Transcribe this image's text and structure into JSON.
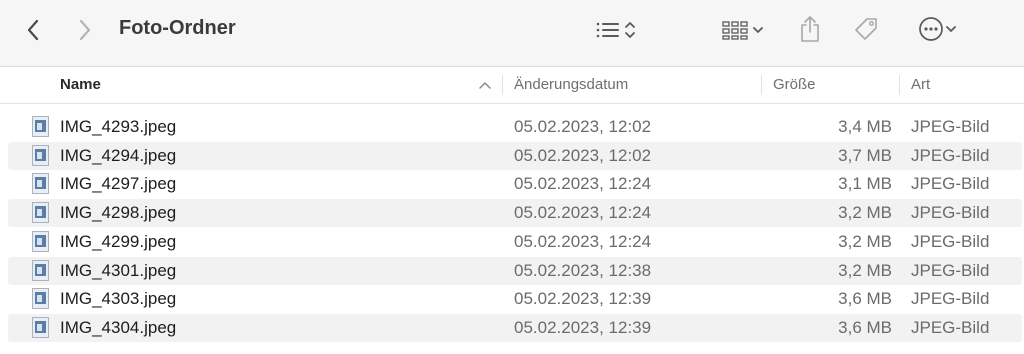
{
  "window": {
    "title": "Foto-Ordner"
  },
  "columns": {
    "name": "Name",
    "date": "Änderungsdatum",
    "size": "Größe",
    "kind": "Art"
  },
  "files": [
    {
      "name": "IMG_4293.jpeg",
      "date": "05.02.2023, 12:02",
      "size": "3,4 MB",
      "kind": "JPEG-Bild"
    },
    {
      "name": "IMG_4294.jpeg",
      "date": "05.02.2023, 12:02",
      "size": "3,7 MB",
      "kind": "JPEG-Bild"
    },
    {
      "name": "IMG_4297.jpeg",
      "date": "05.02.2023, 12:24",
      "size": "3,1 MB",
      "kind": "JPEG-Bild"
    },
    {
      "name": "IMG_4298.jpeg",
      "date": "05.02.2023, 12:24",
      "size": "3,2 MB",
      "kind": "JPEG-Bild"
    },
    {
      "name": "IMG_4299.jpeg",
      "date": "05.02.2023, 12:24",
      "size": "3,2 MB",
      "kind": "JPEG-Bild"
    },
    {
      "name": "IMG_4301.jpeg",
      "date": "05.02.2023, 12:38",
      "size": "3,2 MB",
      "kind": "JPEG-Bild"
    },
    {
      "name": "IMG_4303.jpeg",
      "date": "05.02.2023, 12:39",
      "size": "3,6 MB",
      "kind": "JPEG-Bild"
    },
    {
      "name": "IMG_4304.jpeg",
      "date": "05.02.2023, 12:39",
      "size": "3,6 MB",
      "kind": "JPEG-Bild"
    }
  ],
  "icons": {
    "back": "chevron-left-icon",
    "forward": "chevron-right-icon",
    "view": "list-view-icon",
    "group": "icon-grid-icon",
    "share": "share-icon",
    "tags": "tag-icon",
    "more": "ellipsis-circle-icon",
    "file": "jpeg-file-icon"
  },
  "colors": {
    "toolbar": "#f6f6f6",
    "row_alt": "#f2f2f2",
    "text": "#1d1d1f",
    "secondary": "#6b6b6b"
  }
}
